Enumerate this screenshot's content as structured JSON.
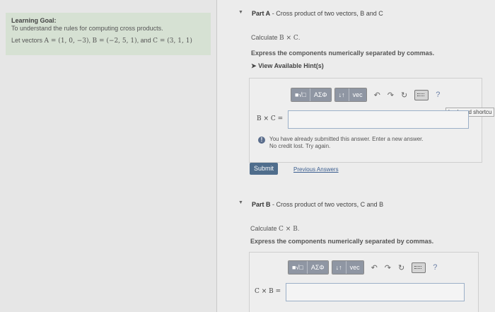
{
  "learning_goal": {
    "title": "Learning Goal:",
    "description": "To understand the rules for computing cross products.",
    "vectors_prefix": "Let vectors",
    "vector_a": "A = (1, 0, −3)",
    "vector_b": "B = (−2, 5, 1)",
    "and_text": "and",
    "vector_c": "C = (3, 1, 1)"
  },
  "part_a": {
    "label": "Part A",
    "title": "- Cross product of two vectors, B and C",
    "calculate_prefix": "Calculate",
    "calculate_expr": "B × C",
    "calculate_suffix": ".",
    "instruction": "Express the components numerically separated by commas.",
    "hints_link": "View Available Hint(s)",
    "toolbar": {
      "sqrt": "■√□",
      "greek": "ΑΣΦ",
      "arrows": "↓↑",
      "vec": "vec",
      "help": "?"
    },
    "tooltip": "keyboard shortcu",
    "answer_label": "B × C =",
    "answer_value": "",
    "warning_line1": "You have already submitted this answer. Enter a new answer.",
    "warning_line2": "No credit lost. Try again.",
    "submit_label": "Submit",
    "previous_answers_label": "Previous Answers"
  },
  "part_b": {
    "label": "Part B",
    "title": "- Cross product of two vectors, C and B",
    "calculate_prefix": "Calculate",
    "calculate_expr": "C × B",
    "calculate_suffix": ".",
    "instruction": "Express the components numerically separated by commas.",
    "toolbar": {
      "sqrt": "■√□",
      "greek": "ΑΣΦ",
      "arrows": "↓↑",
      "vec": "vec",
      "help": "?"
    },
    "answer_label": "C × B =",
    "answer_value": ""
  },
  "icons": {
    "undo": "undo-icon",
    "redo": "redo-icon",
    "reset": "reset-icon",
    "keyboard": "keyboard-icon",
    "help": "help-icon"
  }
}
